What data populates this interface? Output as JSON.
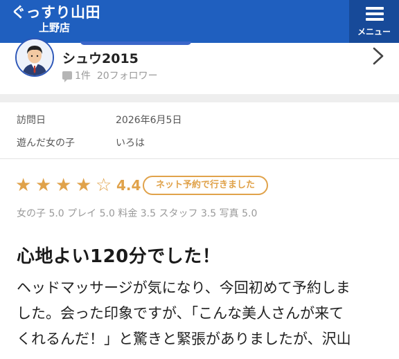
{
  "header": {
    "logo_line1": "ぐっすり山田",
    "logo_line2": "上野店",
    "menu_label": "メニュー"
  },
  "reviewer": {
    "name": "シュウ2015",
    "review_count": "1件",
    "followers": "20フォロワー"
  },
  "visit_info": [
    {
      "label": "訪問日",
      "value": "2026年6月5日"
    },
    {
      "label": "遊んだ女の子",
      "value": "いろは"
    }
  ],
  "rating": {
    "stars_filled": 4,
    "stars_total": 5,
    "score": "4.4",
    "badge": "ネット予約で行きました",
    "star_color": "#e0a24a",
    "sub_scores": "女の子 5.0 プレイ 5.0 料金 3.5 スタッフ 3.5 写真 5.0"
  },
  "review": {
    "title": "心地よい120分でした！",
    "body_lines": [
      "ヘッドマッサージが気になり、今回初めて予約しま",
      "した。会った印象ですが、「こんな美人さんが来て",
      "くれるんだ！」と驚きと緊張がありましたが、沢山"
    ]
  },
  "colors": {
    "header_bg": "#1f5fbf",
    "menu_bg": "#174a99",
    "accent": "#e0a24a"
  }
}
